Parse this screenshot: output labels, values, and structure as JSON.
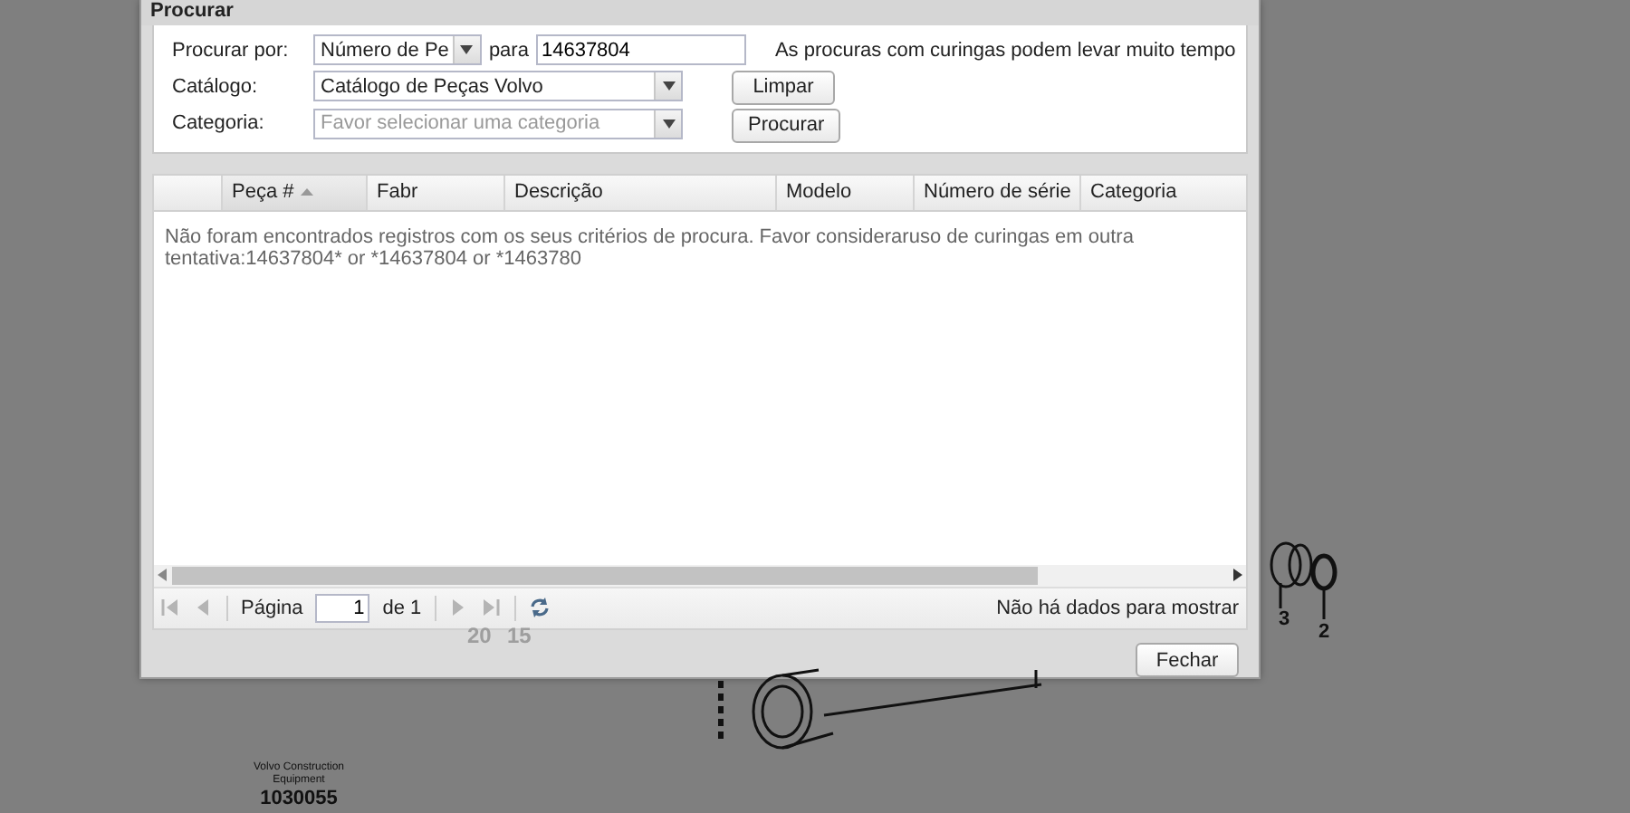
{
  "window": {
    "title": "Procurar"
  },
  "form": {
    "search_by": {
      "label": "Procurar por:",
      "value": "Número de Pe"
    },
    "search_for": {
      "label": "para",
      "value": "14637804"
    },
    "note": "As procuras com curingas podem levar muito tempo",
    "catalog": {
      "label": "Catálogo:",
      "value": "Catálogo de Peças Volvo"
    },
    "category": {
      "label": "Categoria:",
      "placeholder": "Favor selecionar uma categoria"
    },
    "buttons": [
      {
        "label": "Limpar"
      },
      {
        "label": "Procurar"
      }
    ]
  },
  "grid": {
    "columns": [
      {
        "label": "Peça #",
        "sorted": true
      },
      {
        "label": "Fabr",
        "sorted": false
      },
      {
        "label": "Descrição",
        "sorted": false
      },
      {
        "label": "Modelo",
        "sorted": false
      },
      {
        "label": "Número de série",
        "sorted": false
      },
      {
        "label": "Categoria",
        "sorted": false
      }
    ],
    "empty_message": "Não foram encontrados registros com os seus critérios de procura. Favor consideraruso de curingas em outra tentativa:14637804* or *14637804 or *1463780"
  },
  "pager": {
    "buttons": [
      {
        "kind": "first",
        "disabled": true
      },
      {
        "kind": "prev",
        "disabled": true
      },
      {
        "kind": "next",
        "disabled": true
      },
      {
        "kind": "last",
        "disabled": true
      },
      {
        "kind": "refresh",
        "disabled": false
      }
    ],
    "page_label": "Página",
    "page": "1",
    "of": "de 1",
    "status": "Não há dados para mostrar"
  },
  "footer": {
    "buttons": [
      {
        "label": "Fechar"
      }
    ]
  },
  "diagram": {
    "callouts": [
      "20",
      "15",
      "3",
      "2"
    ],
    "logo_lines": [
      "Volvo Construction",
      "Equipment"
    ],
    "drawing_number": "1030055"
  }
}
